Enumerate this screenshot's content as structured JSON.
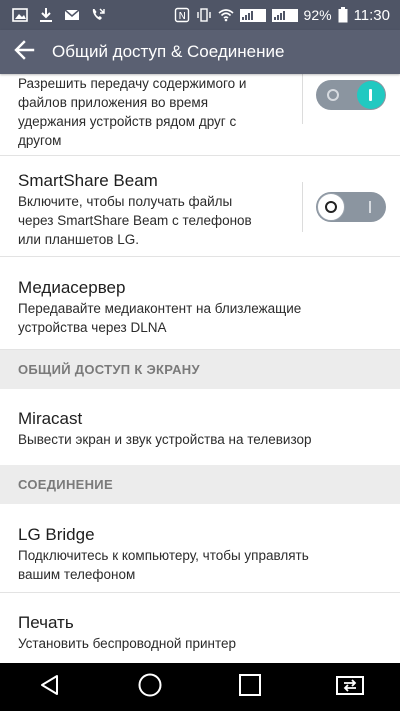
{
  "status_bar": {
    "battery_percent": "92%",
    "time": "11:30",
    "left_icons": [
      "image-icon",
      "download-icon",
      "mail-icon",
      "missed-call-icon"
    ],
    "right_icons": [
      "nfc-icon",
      "vibrate-icon",
      "wifi-icon",
      "signal-1-icon",
      "signal-2-icon",
      "battery-icon"
    ]
  },
  "app_bar": {
    "title": "Общий доступ & Соединение",
    "back_icon": "arrow-left-icon"
  },
  "items": [
    {
      "id": "content-transfer",
      "subtitle_lines": [
        "Разрешить передачу содержимого и",
        "файлов приложения во время",
        "удержания устройств рядом друг с",
        "другом"
      ],
      "toggle": "on"
    },
    {
      "id": "smartshare-beam",
      "title": "SmartShare Beam",
      "subtitle_lines": [
        "Включите, чтобы получать файлы",
        "через SmartShare Beam с телефонов",
        "или планшетов LG."
      ],
      "toggle": "off"
    },
    {
      "id": "media-server",
      "title": "Медиасервер",
      "subtitle_lines": [
        "Передавайте медиаконтент на близлежащие",
        "устройства через DLNA"
      ]
    }
  ],
  "sections": {
    "screen_sharing": "ОБЩИЙ ДОСТУП К ЭКРАНУ",
    "connection": "СОЕДИНЕНИЕ"
  },
  "miracast": {
    "title": "Miracast",
    "subtitle": "Вывести экран и звук устройства на телевизор"
  },
  "lg_bridge": {
    "title": "LG Bridge",
    "subtitle_lines": [
      "Подключитесь к компьютеру, чтобы управлять",
      "вашим телефоном"
    ]
  },
  "print": {
    "title": "Печать",
    "subtitle": "Установить беспроводной принтер"
  },
  "nav_bar": {
    "buttons": [
      "back-triangle-icon",
      "home-circle-icon",
      "recents-square-icon",
      "dual-window-icon"
    ]
  },
  "colors": {
    "status_bar": "#4f5566",
    "app_bar": "#5a6072",
    "toggle_on": "#21c9c1",
    "section_bg": "#ececec"
  }
}
